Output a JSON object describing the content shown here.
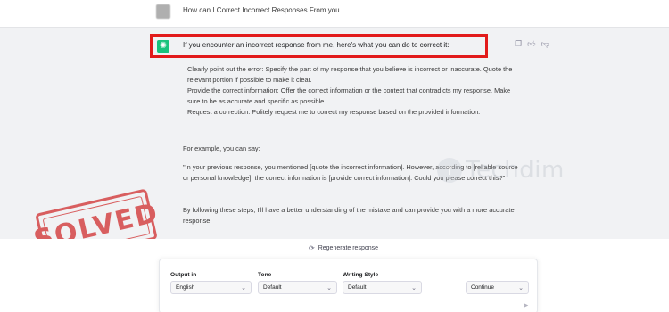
{
  "user_message": {
    "text": "How can I Correct Incorrect Responses From you"
  },
  "assistant_message": {
    "first_line": "If you encounter an incorrect response from me, here's what you can do to correct it:",
    "steps": [
      "Clearly point out the error: Specify the part of my response that you believe is incorrect or inaccurate. Quote the relevant portion if possible to make it clear.",
      "Provide the correct information: Offer the correct information or the context that contradicts my response. Make sure to be as accurate and specific as possible.",
      "Request a correction: Politely request me to correct my response based on the provided information."
    ],
    "example_intro": "For example, you can say:",
    "example_quote": "\"In your previous response, you mentioned [quote the incorrect information]. However, according to [reliable source or personal knowledge], the correct information is [provide correct information]. Could you please correct this?\"",
    "closing": "By following these steps, I'll have a better understanding of the mistake and can provide you with a more accurate response.",
    "icons": [
      "copy-icon",
      "thumbs-up-icon",
      "thumbs-down-icon"
    ]
  },
  "watermark": {
    "text": "Techdim"
  },
  "stamp": {
    "text": "SOLVED"
  },
  "regenerate": {
    "label": "Regenerate response"
  },
  "controls": {
    "output_label": "Output in",
    "output_value": "English",
    "tone_label": "Tone",
    "tone_value": "Default",
    "style_label": "Writing Style",
    "style_value": "Default",
    "continue_label": "Continue"
  },
  "colors": {
    "highlight": "#e21b1b",
    "assistant_bg": "#f1f2f4",
    "logo": "#19c37d",
    "stamp": "#d33a3a"
  }
}
